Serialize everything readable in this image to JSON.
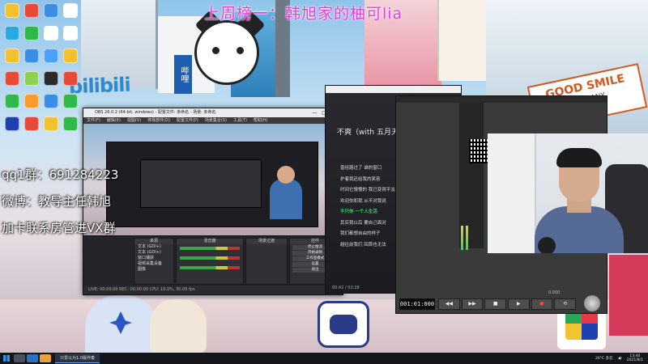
{
  "overlay": {
    "caption": "上周榜一：韩旭家的柚可lia",
    "left_lines": [
      "qq1群：691284223",
      "微博：教导主任韩旭",
      "加卡联系房管进VX群"
    ]
  },
  "wallpaper": {
    "sign_bilibili": "bilibili",
    "sign_smile": "GOOD SMILE",
    "sign_smile_sub": "COMPANY",
    "sign_cjk": "哔哩"
  },
  "desktop_icons": [
    {
      "name": "app-1",
      "label": "",
      "color": "#f2c12e"
    },
    {
      "name": "app-2",
      "label": "",
      "color": "#e84a3a"
    },
    {
      "name": "app-3",
      "label": "",
      "color": "#3a8ee6"
    },
    {
      "name": "app-4",
      "label": "",
      "color": "#ffffff"
    },
    {
      "name": "app-5",
      "label": "",
      "color": "#29a9e0"
    },
    {
      "name": "app-6",
      "label": "",
      "color": "#2fb94a"
    },
    {
      "name": "app-7",
      "label": "",
      "color": "#ffffff"
    },
    {
      "name": "app-8",
      "label": "",
      "color": "#ffffff"
    },
    {
      "name": "app-9",
      "label": "",
      "color": "#f2c12e"
    },
    {
      "name": "app-10",
      "label": "",
      "color": "#3a8ee6"
    },
    {
      "name": "app-11",
      "label": "",
      "color": "#4aa0ff"
    },
    {
      "name": "app-12",
      "label": "",
      "color": "#f2c12e"
    },
    {
      "name": "app-13",
      "label": "",
      "color": "#e84a3a"
    },
    {
      "name": "app-14",
      "label": "",
      "color": "#8fd14f"
    },
    {
      "name": "app-15",
      "label": "",
      "color": "#2b2b2b"
    },
    {
      "name": "app-16",
      "label": "",
      "color": "#e84a3a"
    },
    {
      "name": "app-17",
      "label": "",
      "color": "#2fb94a"
    },
    {
      "name": "app-18",
      "label": "",
      "color": "#ff9b2e"
    },
    {
      "name": "app-19",
      "label": "",
      "color": "#3a8ee6"
    },
    {
      "name": "app-20",
      "label": "",
      "color": "#2fb94a"
    },
    {
      "name": "app-21",
      "label": "",
      "color": "#1d3fb0"
    },
    {
      "name": "app-22",
      "label": "",
      "color": "#e84a3a"
    },
    {
      "name": "app-23",
      "label": "",
      "color": "#f2c12e"
    },
    {
      "name": "app-24",
      "label": "",
      "color": "#2fb94a"
    }
  ],
  "obs": {
    "title": "OBS 26.0.2 (64-bit, windows) - 配置文件: 未命名 - 场景: 未命名",
    "menu": [
      "文件(F)",
      "编辑(E)",
      "视图(V)",
      "停靠部件(D)",
      "配置文件(P)",
      "场景集合(S)",
      "工具(T)",
      "帮助(H)"
    ],
    "docks": {
      "sources_title": "来源",
      "sources": [
        "文本 (GDI+)",
        "文本 (GDI+)",
        "窗口捕获",
        "视频采集设备",
        "图像"
      ],
      "mixer_title": "混音器",
      "transitions_title": "场景过渡",
      "controls_title": "控件",
      "controls": [
        "停止推流",
        "开始录制",
        "工作室模式",
        "设置",
        "退出"
      ]
    },
    "status": "LIVE: 00:00:00   REC: 00:00:00   CPU: 10.0%, 30.00 fps"
  },
  "music": {
    "song_title": "不爽（with 五月天...",
    "lyrics": [
      "曾经路过了 谁的窗口",
      "护着我还给我的笑容",
      "时间它慢慢的 我已变得平淡",
      "欢迎你和我 从不对我说",
      "不只你 一个人生活",
      "其实我以后 要自己面对",
      "我们都想自由的样子",
      "越往前我们 回首也无法"
    ],
    "active_index": 4,
    "footer": "00:42 / 03:28"
  },
  "daw": {
    "time": "001:01:000",
    "transport": [
      "◀◀",
      "▶▶",
      "■",
      "▶",
      "●",
      "⟲"
    ],
    "label": "0.000"
  },
  "taskbar": {
    "active_app": "只爱以为1.0版伴奏",
    "tray_temp": "26°C 多云",
    "clock_time": "13:40",
    "clock_date": "2021/8/1"
  }
}
